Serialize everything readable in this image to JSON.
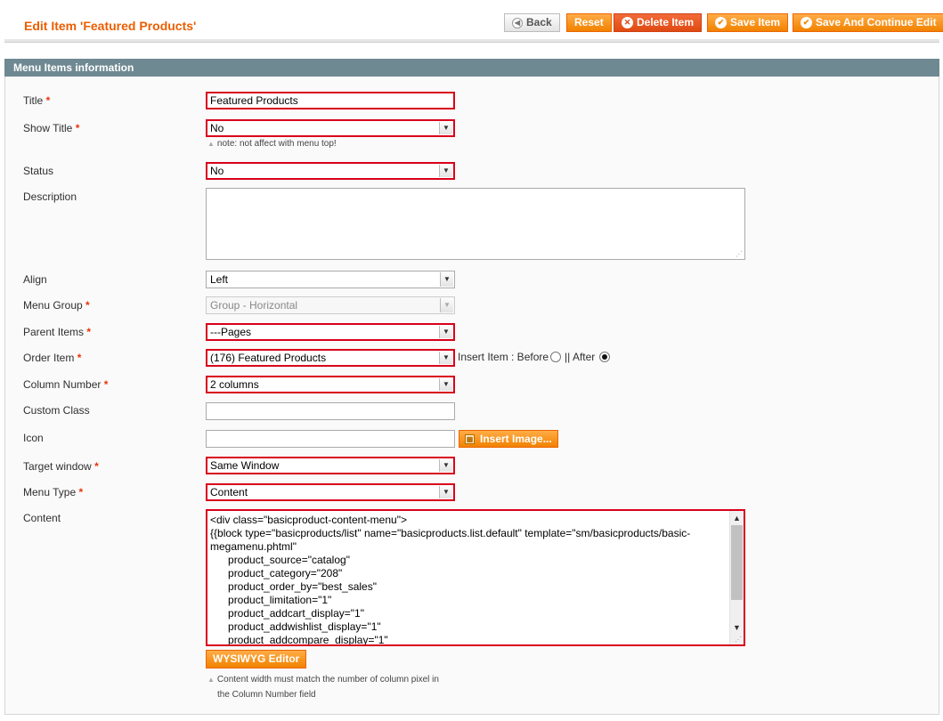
{
  "header": {
    "title": "Edit Item 'Featured Products'",
    "buttons": {
      "back": "Back",
      "reset": "Reset",
      "delete": "Delete Item",
      "save": "Save Item",
      "save_continue": "Save And Continue Edit"
    }
  },
  "section": {
    "title": "Menu Items information"
  },
  "fields": {
    "title": {
      "label": "Title",
      "value": "Featured Products"
    },
    "show_title": {
      "label": "Show Title",
      "value": "No",
      "note": "note: not affect with menu top!"
    },
    "status": {
      "label": "Status",
      "value": "No"
    },
    "description": {
      "label": "Description",
      "value": ""
    },
    "align": {
      "label": "Align",
      "value": "Left"
    },
    "menu_group": {
      "label": "Menu Group",
      "value": "Group - Horizontal"
    },
    "parent_items": {
      "label": "Parent Items",
      "value": "---Pages"
    },
    "order_item": {
      "label": "Order Item",
      "value": "(176) Featured Products",
      "insert_label": "Insert Item : Before",
      "after_label": "|| After",
      "selected_option": "After"
    },
    "column_number": {
      "label": "Column Number",
      "value": "2 columns"
    },
    "custom_class": {
      "label": "Custom Class",
      "value": ""
    },
    "icon": {
      "label": "Icon",
      "value": "",
      "button": "Insert Image..."
    },
    "target_window": {
      "label": "Target window",
      "value": "Same Window"
    },
    "menu_type": {
      "label": "Menu Type",
      "value": "Content"
    },
    "content": {
      "label": "Content",
      "value": "<div class=\"basicproduct-content-menu\">\n{{block type=\"basicproducts/list\" name=\"basicproducts.list.default\" template=\"sm/basicproducts/basic-\nmegamenu.phtml\"\n      product_source=\"catalog\"\n      product_category=\"208\"\n      product_order_by=\"best_sales\"\n      product_limitation=\"1\"\n      product_addcart_display=\"1\"\n      product_addwishlist_display=\"1\"\n      product_addcompare_display=\"1\"",
      "editor_button": "WYSIWYG Editor",
      "note_line1": "Content width must match the number of column pixel in",
      "note_line2": "the Column Number field"
    }
  },
  "required_mark": "*",
  "colors": {
    "accent": "#eb5e00",
    "button": "#f18200",
    "header_bar": "#6f8992",
    "error_border": "#d9001b"
  }
}
